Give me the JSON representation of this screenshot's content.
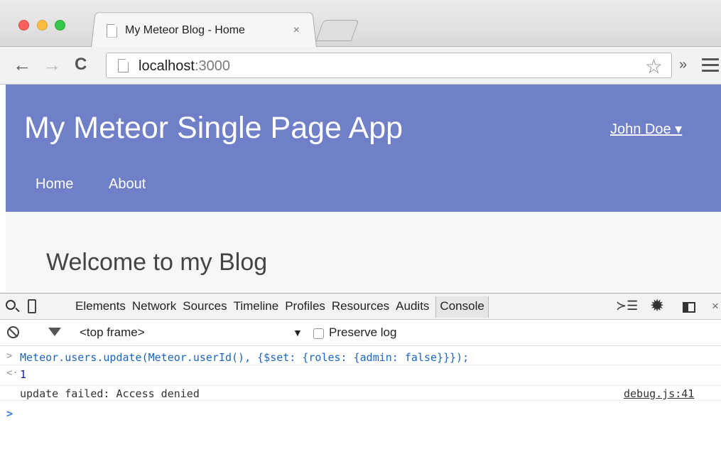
{
  "browser": {
    "tab_title": "My Meteor Blog - Home",
    "tab_close": "×",
    "url_host": "localhost",
    "url_port": ":3000",
    "overflow_label": "»"
  },
  "site": {
    "brand": "My Meteor Single Page App",
    "user_menu": "John Doe ▾",
    "nav": [
      {
        "label": "Home"
      },
      {
        "label": "About"
      }
    ],
    "welcome": "Welcome to my Blog",
    "header_color": "#6f7fc8"
  },
  "devtools": {
    "tabs": [
      "Elements",
      "Network",
      "Sources",
      "Timeline",
      "Profiles",
      "Resources",
      "Audits",
      "Console"
    ],
    "active_tab": "Console",
    "exec_icon": "≻☰",
    "gear_icon": "✹",
    "close_icon": "×",
    "filter": {
      "frame": "<top frame>",
      "frame_arrow": "▼",
      "preserve_log": "Preserve log",
      "preserve_checked": false
    },
    "console": {
      "command": "Meteor.users.update(Meteor.userId(), {$set: {roles: {admin: false}}});",
      "command_prompt": ">",
      "result_prompt": "<·",
      "result": "1",
      "error": "update failed: Access denied",
      "error_source": "debug.js:41",
      "input_prompt": ">"
    }
  }
}
